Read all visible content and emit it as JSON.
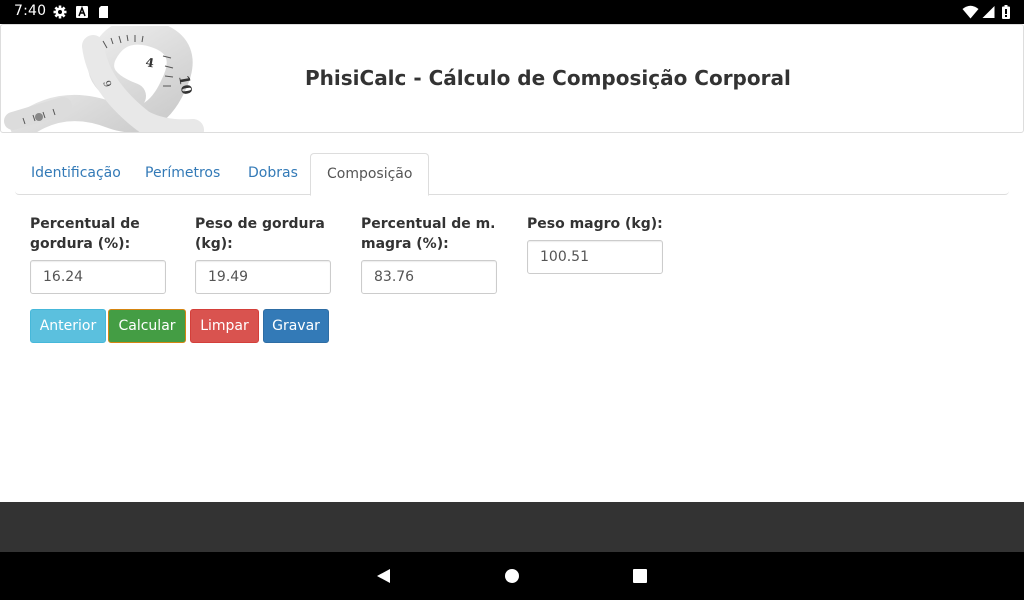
{
  "status_bar": {
    "time": "7:40",
    "icons": [
      "gear-icon",
      "a-icon",
      "sd-card-icon",
      "wifi-icon",
      "signal-icon",
      "battery-icon"
    ]
  },
  "header": {
    "title": "PhisiCalc - Cálculo de Composição Corporal",
    "image": "measuring-tape-image"
  },
  "tabs": [
    {
      "label": "Identificação",
      "active": false
    },
    {
      "label": "Perímetros",
      "active": false
    },
    {
      "label": "Dobras",
      "active": false
    },
    {
      "label": "Composição",
      "active": true
    }
  ],
  "fields": [
    {
      "label": "Percentual de gordura (%):",
      "value": "16.24"
    },
    {
      "label": "Peso de gordura (kg):",
      "value": "19.49"
    },
    {
      "label": "Percentual de m. magra (%):",
      "value": "83.76"
    },
    {
      "label": "Peso magro (kg):",
      "value": "100.51"
    }
  ],
  "buttons": {
    "previous": "Anterior",
    "calculate": "Calcular",
    "clear": "Limpar",
    "save": "Gravar"
  },
  "colors": {
    "status_bar": "#000000",
    "link": "#337ab7",
    "btn_info": "#5bc0de",
    "btn_success": "#449d44",
    "btn_danger": "#d9534f",
    "btn_primary": "#337ab7",
    "footer": "#333333"
  },
  "nav_bar": {
    "icons": [
      "back-icon",
      "home-icon",
      "recents-icon"
    ]
  }
}
